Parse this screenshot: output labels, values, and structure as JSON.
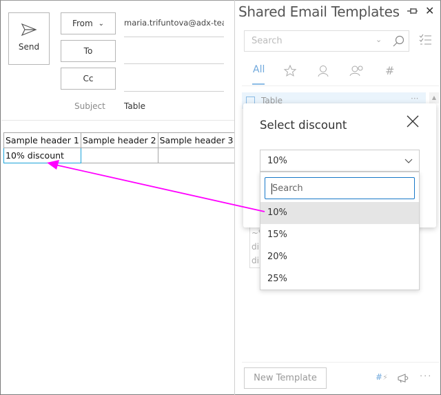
{
  "compose": {
    "send_label": "Send",
    "from_label": "From",
    "from_value": "maria.trifuntova@adx-team",
    "to_label": "To",
    "cc_label": "Cc",
    "subject_label": "Subject",
    "subject_value": "Table",
    "table": {
      "headers": [
        "Sample header 1",
        "Sample header 2",
        "Sample header 3"
      ],
      "rows": [
        [
          "10% discount",
          "",
          ""
        ]
      ]
    }
  },
  "pane": {
    "title": "Shared Email Templates",
    "search_placeholder": "Search",
    "tabs": [
      {
        "label": "All",
        "icon": "all"
      },
      {
        "label": "",
        "icon": "star-icon"
      },
      {
        "label": "",
        "icon": "person-icon"
      },
      {
        "label": "",
        "icon": "people-icon"
      },
      {
        "label": "",
        "icon": "hash-icon"
      }
    ],
    "template_item": "Table",
    "preview_lines": [
      "~%",
      "di",
      "di"
    ],
    "new_template_label": "New Template",
    "more_label": "···",
    "accent_color": "#6fa8dc"
  },
  "dialog": {
    "title": "Select discount",
    "selected_value": "10%",
    "search_placeholder": "Search",
    "options": [
      "10%",
      "15%",
      "20%",
      "25%"
    ],
    "highlighted_option": "10%"
  },
  "annotation": {
    "arrow_color": "#ff00ff"
  }
}
